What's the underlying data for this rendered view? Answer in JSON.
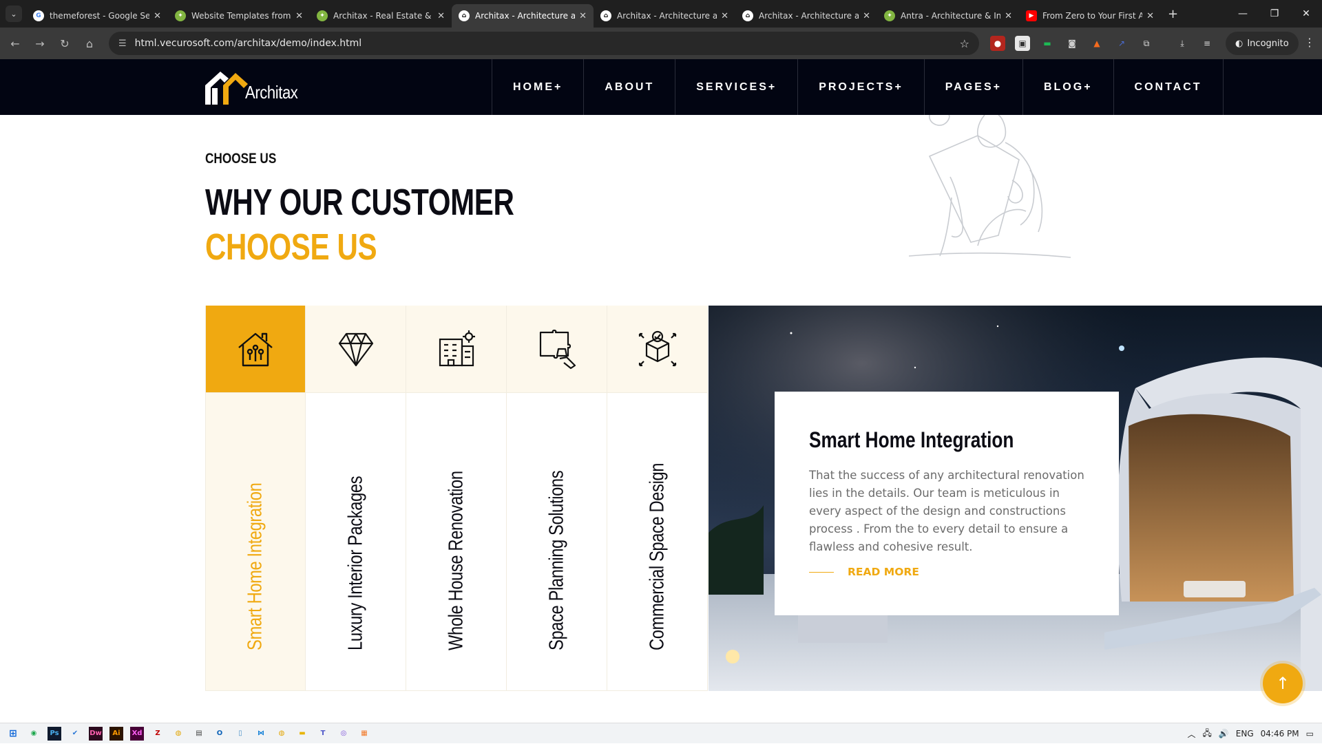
{
  "browser": {
    "tabs": [
      {
        "title": "themeforest - Google Sea",
        "favicon": "google-icon",
        "active": false
      },
      {
        "title": "Website Templates from T",
        "favicon": "envato-icon",
        "active": false
      },
      {
        "title": "Architax - Real Estate & In",
        "favicon": "envato-icon",
        "active": false
      },
      {
        "title": "Architax - Architecture an",
        "favicon": "architax-icon",
        "active": true
      },
      {
        "title": "Architax - Architecture an",
        "favicon": "architax-icon",
        "active": false
      },
      {
        "title": "Architax - Architecture an",
        "favicon": "architax-icon",
        "active": false
      },
      {
        "title": "Antra - Architecture & Int",
        "favicon": "envato-icon",
        "active": false
      },
      {
        "title": "From Zero to Your First A",
        "favicon": "youtube-icon",
        "active": false
      }
    ],
    "url": "html.vecurosoft.com/architax/demo/index.html",
    "incognito_label": "Incognito"
  },
  "site": {
    "logo_text": "Architax",
    "nav": [
      "HOME+",
      "ABOUT",
      "SERVICES+",
      "PROJECTS+",
      "PAGES+",
      "BLOG+",
      "CONTACT"
    ]
  },
  "section": {
    "eyebrow": "CHOOSE US",
    "heading_line1": "WHY OUR CUSTOMER",
    "heading_line2": "CHOOSE US",
    "services": [
      {
        "label": "Smart Home Integration",
        "icon": "smart-home-icon",
        "active": true
      },
      {
        "label": "Luxury Interior Packages",
        "icon": "diamond-icon",
        "active": false
      },
      {
        "label": "Whole House Renovation",
        "icon": "building-gear-icon",
        "active": false
      },
      {
        "label": "Space Planning Solutions",
        "icon": "puzzle-icon",
        "active": false
      },
      {
        "label": "Commercial Space Design",
        "icon": "box-check-icon",
        "active": false
      }
    ],
    "card": {
      "title": "Smart Home Integration",
      "text": "That the success of any architectural renovation lies in the details. Our team is meticulous in every aspect of the design and constructions process . From the to every detail to ensure a flawless and cohesive result.",
      "link": "READ MORE"
    }
  },
  "taskbar": {
    "language": "ENG",
    "time": "04:46 PM"
  },
  "colors": {
    "accent": "#f0a911",
    "dark": "#020512"
  }
}
